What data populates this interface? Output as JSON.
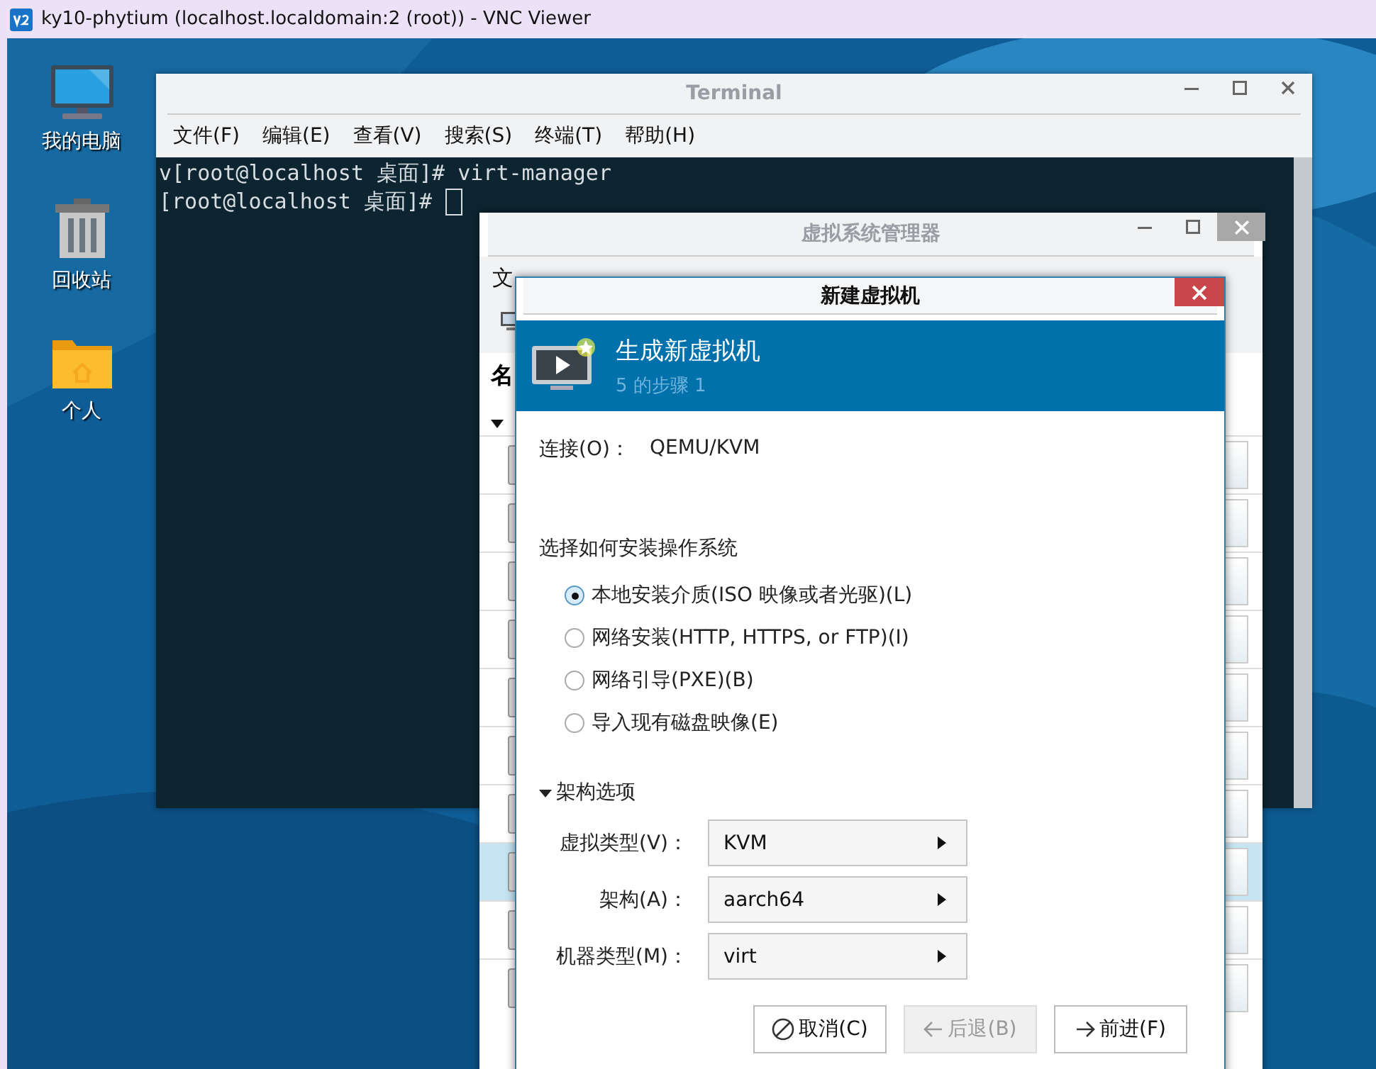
{
  "vnc_window": {
    "title": "ky10-phytium (localhost.localdomain:2 (root)) - VNC Viewer"
  },
  "desktop_icons": [
    {
      "label": "我的电脑",
      "kind": "computer"
    },
    {
      "label": "回收站",
      "kind": "trash"
    },
    {
      "label": "个人",
      "kind": "folder"
    }
  ],
  "terminal": {
    "title": "Terminal",
    "menu": [
      "文件(F)",
      "编辑(E)",
      "查看(V)",
      "搜索(S)",
      "终端(T)",
      "帮助(H)"
    ],
    "lines": [
      "v[root@localhost 桌面]# virt-manager",
      "[root@localhost 桌面]# "
    ]
  },
  "manager": {
    "title": "虚拟系统管理器",
    "menu": [
      "文"
    ],
    "column_header": "名",
    "rows": [
      {
        "selected": false
      },
      {
        "selected": false
      },
      {
        "selected": false
      },
      {
        "selected": false
      },
      {
        "selected": false
      },
      {
        "selected": false
      },
      {
        "selected": false
      },
      {
        "selected": true
      },
      {
        "selected": false
      },
      {
        "selected": false
      }
    ]
  },
  "dialog": {
    "title": "新建虚拟机",
    "header": {
      "title": "生成新虚拟机",
      "step": "5 的步骤 1"
    },
    "connection": {
      "label": "连接(O)：",
      "value": "QEMU/KVM"
    },
    "install_prompt": "选择如何安装操作系统",
    "install_options": [
      {
        "label": "本地安装介质(ISO 映像或者光驱)(L)",
        "selected": true
      },
      {
        "label": "网络安装(HTTP, HTTPS, or FTP)(I)",
        "selected": false
      },
      {
        "label": "网络引导(PXE)(B)",
        "selected": false
      },
      {
        "label": "导入现有磁盘映像(E)",
        "selected": false
      }
    ],
    "arch_section": {
      "label": "架构选项",
      "expanded": true,
      "fields": [
        {
          "label": "虚拟类型(V)：",
          "value": "KVM"
        },
        {
          "label": "架构(A)：",
          "value": "aarch64"
        },
        {
          "label": "机器类型(M)：",
          "value": "virt"
        }
      ]
    },
    "buttons": [
      {
        "label": "取消(C)",
        "kind": "cancel",
        "disabled": false
      },
      {
        "label": "后退(B)",
        "kind": "back",
        "disabled": true
      },
      {
        "label": "前进(F)",
        "kind": "forward",
        "disabled": false
      }
    ]
  }
}
